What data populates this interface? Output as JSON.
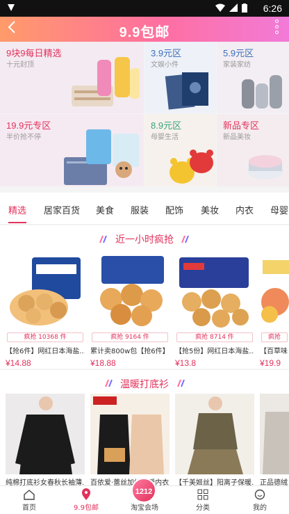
{
  "status": {
    "time": "6:26"
  },
  "header": {
    "back_icon": "back-icon",
    "title": "9.9包邮",
    "more_icon": "more-vertical-icon"
  },
  "categories": [
    {
      "title": "9块9每日精选",
      "subtitle": "十元封顶",
      "color": "#e2315b"
    },
    {
      "title": "3.9元区",
      "subtitle": "文娱小件",
      "color": "#3d6fb8"
    },
    {
      "title": "5.9元区",
      "subtitle": "家装家纺",
      "color": "#3d6fb8"
    },
    {
      "title": "19.9元专区",
      "subtitle": "半价抢不停",
      "color": "#e2315b"
    },
    {
      "title": "8.9元区",
      "subtitle": "母婴生活",
      "color": "#3aa37a"
    },
    {
      "title": "新品专区",
      "subtitle": "新品美妆",
      "color": "#e2315b"
    }
  ],
  "tabs": [
    "精选",
    "居家百货",
    "美食",
    "服装",
    "配饰",
    "美妆",
    "内衣",
    "母婴"
  ],
  "section_flash": {
    "title": "近一小时疯抢"
  },
  "flash_products": [
    {
      "badge": "疯抢 10368 件",
      "name": "【抢6件】网红日本海盐...",
      "price": "¥14.88"
    },
    {
      "badge": "疯抢 9164 件",
      "name": "累计卖800w包【抢6件】...",
      "price": "¥18.88"
    },
    {
      "badge": "疯抢 8714 件",
      "name": "【抢5份】网红日本海盐...",
      "price": "¥13.8"
    },
    {
      "badge": "疯抢",
      "name": "【百草味",
      "price": "¥19.9"
    }
  ],
  "section_warm": {
    "title": "温暖打底衫"
  },
  "warm_products": [
    {
      "name": "纯棉打底衫女春秋长袖薄..."
    },
    {
      "name": "百依爱·蕾丝加绒保暖内衣..."
    },
    {
      "name": "【千美姬丝】阳离子保暖..."
    },
    {
      "name": "正品德绒"
    }
  ],
  "bottom_nav": [
    {
      "label": "首页",
      "icon": "home-icon"
    },
    {
      "label": "9.9包邮",
      "icon": "location-icon"
    },
    {
      "label": "淘宝会场",
      "icon": "fab-icon"
    },
    {
      "label": "分类",
      "icon": "grid-icon"
    },
    {
      "label": "我的",
      "icon": "user-icon"
    }
  ],
  "fab": {
    "label": "1212"
  },
  "colors": {
    "accent": "#e2315b",
    "header_start": "#ff9b6a",
    "header_end": "#f17bd8"
  }
}
